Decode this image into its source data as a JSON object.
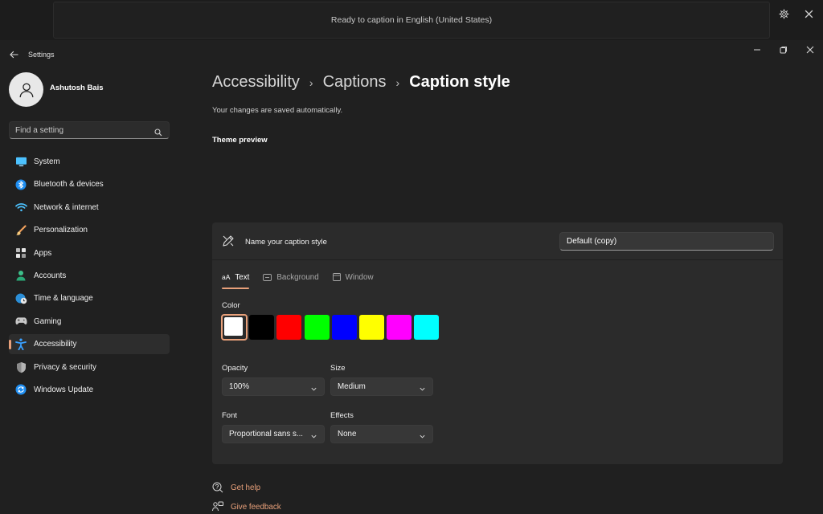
{
  "caption_bar": {
    "text": "Ready to caption in English (United States)"
  },
  "window": {
    "title": "Settings"
  },
  "user": {
    "name": "Ashutosh Bais"
  },
  "search": {
    "placeholder": "Find a setting"
  },
  "nav": {
    "items": [
      {
        "label": "System",
        "icon": "system-icon"
      },
      {
        "label": "Bluetooth & devices",
        "icon": "bluetooth-icon"
      },
      {
        "label": "Network & internet",
        "icon": "wifi-icon"
      },
      {
        "label": "Personalization",
        "icon": "brush-icon"
      },
      {
        "label": "Apps",
        "icon": "apps-icon"
      },
      {
        "label": "Accounts",
        "icon": "person-icon"
      },
      {
        "label": "Time & language",
        "icon": "globe-clock-icon"
      },
      {
        "label": "Gaming",
        "icon": "gamepad-icon"
      },
      {
        "label": "Accessibility",
        "icon": "accessibility-icon",
        "active": true
      },
      {
        "label": "Privacy & security",
        "icon": "shield-icon"
      },
      {
        "label": "Windows Update",
        "icon": "update-icon"
      }
    ]
  },
  "breadcrumb": {
    "items": [
      "Accessibility",
      "Captions"
    ],
    "current": "Caption style"
  },
  "page": {
    "saved_note": "Your changes are saved automatically.",
    "preview_title": "Theme preview"
  },
  "style_card": {
    "name_label": "Name your caption style",
    "name_value": "Default (copy)",
    "tabs": [
      {
        "label": "Text",
        "icon": "aA",
        "active": true
      },
      {
        "label": "Background",
        "icon": "background-icon"
      },
      {
        "label": "Window",
        "icon": "window-icon"
      }
    ],
    "color_label": "Color",
    "colors": [
      "#ffffff",
      "#000000",
      "#ff0000",
      "#00ff00",
      "#0000ff",
      "#ffff00",
      "#ff00ff",
      "#00ffff"
    ],
    "selected_color": "#ffffff",
    "opacity": {
      "label": "Opacity",
      "value": "100%"
    },
    "size": {
      "label": "Size",
      "value": "Medium"
    },
    "font": {
      "label": "Font",
      "value": "Proportional sans s..."
    },
    "effects": {
      "label": "Effects",
      "value": "None"
    }
  },
  "help": {
    "get_help": "Get help",
    "give_feedback": "Give feedback"
  },
  "accent_color": "#e8a07a"
}
